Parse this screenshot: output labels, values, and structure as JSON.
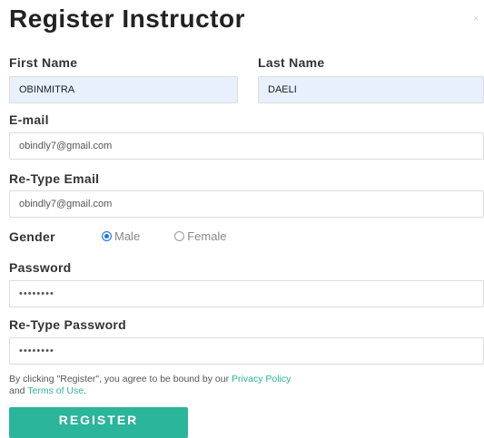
{
  "modal": {
    "title": "Register Instructor",
    "close_glyph": "×"
  },
  "form": {
    "first_name": {
      "label": "First Name",
      "value": "OBINMITRA"
    },
    "last_name": {
      "label": "Last Name",
      "value": "DAELI"
    },
    "email": {
      "label": "E-mail",
      "value": "obindly7@gmail.com"
    },
    "retype_email": {
      "label": "Re-Type Email",
      "value": "obindly7@gmail.com"
    },
    "gender": {
      "label": "Gender",
      "options": [
        {
          "label": "Male",
          "selected": true
        },
        {
          "label": "Female",
          "selected": false
        }
      ]
    },
    "password": {
      "label": "Password",
      "masked_value": "••••••••"
    },
    "retype_password": {
      "label": "Re-Type Password",
      "masked_value": "••••••••"
    }
  },
  "terms": {
    "prefix": "By clicking \"Register\", you agree to be bound by our ",
    "privacy_link": "Privacy Policy",
    "middle": " and ",
    "terms_link": "Terms of Use",
    "suffix": "."
  },
  "actions": {
    "register_label": "REGISTER"
  },
  "colors": {
    "accent": "#2bb59b",
    "autofill_background": "#e8f0fe",
    "radio_checked": "#1a73e8"
  }
}
